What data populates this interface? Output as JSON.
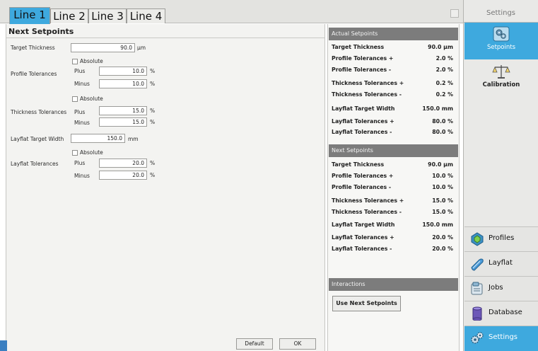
{
  "tabs": [
    {
      "label": "Line 1",
      "active": true
    },
    {
      "label": "Line 2",
      "active": false
    },
    {
      "label": "Line 3",
      "active": false
    },
    {
      "label": "Line 4",
      "active": false
    }
  ],
  "colors": {
    "accent": "#3ea9de",
    "section_header": "#7c7c7c"
  },
  "left": {
    "title": "Next Setpoints",
    "target_thickness": {
      "label": "Target Thickness",
      "value": "90.0",
      "unit": "µm"
    },
    "profile": {
      "absolute_label": "Absolute",
      "label": "Profile Tolerances",
      "plus_label": "Plus",
      "plus_value": "10.0",
      "plus_unit": "%",
      "minus_label": "Minus",
      "minus_value": "10.0",
      "minus_unit": "%"
    },
    "thickness": {
      "absolute_label": "Absolute",
      "label": "Thickness Tolerances",
      "plus_label": "Plus",
      "plus_value": "15.0",
      "plus_unit": "%",
      "minus_label": "Minus",
      "minus_value": "15.0",
      "minus_unit": "%"
    },
    "layflat_width": {
      "label": "Layflat Target Width",
      "value": "150.0",
      "unit": "mm"
    },
    "layflat": {
      "absolute_label": "Absolute",
      "label": "Layflat Tolerances",
      "plus_label": "Plus",
      "plus_value": "20.0",
      "plus_unit": "%",
      "minus_label": "Minus",
      "minus_value": "20.0",
      "minus_unit": "%"
    },
    "default_button": "Default",
    "ok_button": "OK"
  },
  "actual": {
    "header": "Actual Setpoints",
    "rows": [
      {
        "label": "Target Thickness",
        "value": "90.0 µm"
      },
      {
        "label": "Profile Tolerances +",
        "value": "2.0 %"
      },
      {
        "label": "Profile Tolerances -",
        "value": "2.0 %"
      },
      {
        "label": "Thickness Tolerances +",
        "value": "0.2 %"
      },
      {
        "label": "Thickness Tolerances -",
        "value": "0.2 %"
      },
      {
        "label": "Layflat Target Width",
        "value": "150.0 mm"
      },
      {
        "label": "Layflat Tolerances +",
        "value": "80.0 %"
      },
      {
        "label": "Layflat Tolerances -",
        "value": "80.0 %"
      }
    ]
  },
  "next": {
    "header": "Next Setpoints",
    "rows": [
      {
        "label": "Target Thickness",
        "value": "90.0 µm"
      },
      {
        "label": "Profile Tolerances +",
        "value": "10.0 %"
      },
      {
        "label": "Profile Tolerances -",
        "value": "10.0 %"
      },
      {
        "label": "Thickness Tolerances +",
        "value": "15.0 %"
      },
      {
        "label": "Thickness Tolerances -",
        "value": "15.0 %"
      },
      {
        "label": "Layflat Target Width",
        "value": "150.0 mm"
      },
      {
        "label": "Layflat Tolerances +",
        "value": "20.0 %"
      },
      {
        "label": "Layflat Tolerances -",
        "value": "20.0 %"
      }
    ]
  },
  "interactions": {
    "header": "Interactions",
    "button": "Use Next Setpoints"
  },
  "sidebar": {
    "title": "Settings",
    "tiles": [
      {
        "label": "Setpoints",
        "icon": "setpoints-icon",
        "active": true
      },
      {
        "label": "Calibration",
        "icon": "scale-icon",
        "active": false
      }
    ],
    "nav": [
      {
        "label": "Profiles",
        "icon": "profiles-icon",
        "active": false
      },
      {
        "label": "Layflat",
        "icon": "layflat-icon",
        "active": false
      },
      {
        "label": "Jobs",
        "icon": "jobs-icon",
        "active": false
      },
      {
        "label": "Database",
        "icon": "database-icon",
        "active": false
      },
      {
        "label": "Settings",
        "icon": "settings-gears-icon",
        "active": true
      }
    ]
  }
}
